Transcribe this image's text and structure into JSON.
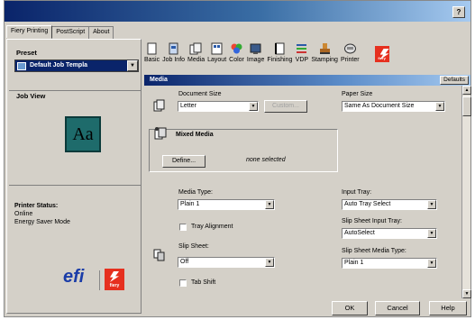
{
  "window": {
    "help_label": "?"
  },
  "tabs": [
    {
      "label": "Fiery Printing"
    },
    {
      "label": "PostScript"
    },
    {
      "label": "About"
    }
  ],
  "left": {
    "preset_label": "Preset",
    "preset_value": "Default Job Templa",
    "job_view_label": "Job View",
    "preview_text": "Aa",
    "printer_status_label": "Printer Status:",
    "status_lines": [
      "Online",
      "Energy Saver Mode"
    ],
    "efi_logo": "efi",
    "fiery_logo": "fiery"
  },
  "toolbar": {
    "items": [
      {
        "label": "Basic",
        "icon": "basic-icon"
      },
      {
        "label": "Job Info",
        "icon": "job-info-icon"
      },
      {
        "label": "Media",
        "icon": "media-icon"
      },
      {
        "label": "Layout",
        "icon": "layout-icon"
      },
      {
        "label": "Color",
        "icon": "color-icon"
      },
      {
        "label": "Image",
        "icon": "image-icon"
      },
      {
        "label": "Finishing",
        "icon": "finishing-icon"
      },
      {
        "label": "VDP",
        "icon": "vdp-icon"
      },
      {
        "label": "Stamping",
        "icon": "stamping-icon"
      },
      {
        "label": "Printer",
        "icon": "printer-icon"
      }
    ],
    "logo": "fiery"
  },
  "section": {
    "title": "Media",
    "defaults_label": "Defaults"
  },
  "media": {
    "document_size_label": "Document Size",
    "document_size_value": "Letter",
    "custom_label": "Custom...",
    "paper_size_label": "Paper Size",
    "paper_size_value": "Same As Document Size",
    "mixed_media_label": "Mixed Media",
    "define_label": "Define...",
    "none_selected": "none selected",
    "media_type_label": "Media Type:",
    "media_type_value": "Plain 1",
    "tray_alignment_label": "Tray Alignment",
    "slip_sheet_label": "Slip Sheet:",
    "slip_sheet_value": "Off",
    "tab_shift_label": "Tab Shift",
    "input_tray_label": "Input Tray:",
    "input_tray_value": "Auto Tray Select",
    "slip_sheet_input_tray_label": "Slip Sheet Input Tray:",
    "slip_sheet_input_tray_value": "AutoSelect",
    "slip_sheet_media_type_label": "Slip Sheet Media Type:",
    "slip_sheet_media_type_value": "Plain 1"
  },
  "footer": {
    "ok_label": "OK",
    "cancel_label": "Cancel",
    "help_label": "Help"
  }
}
